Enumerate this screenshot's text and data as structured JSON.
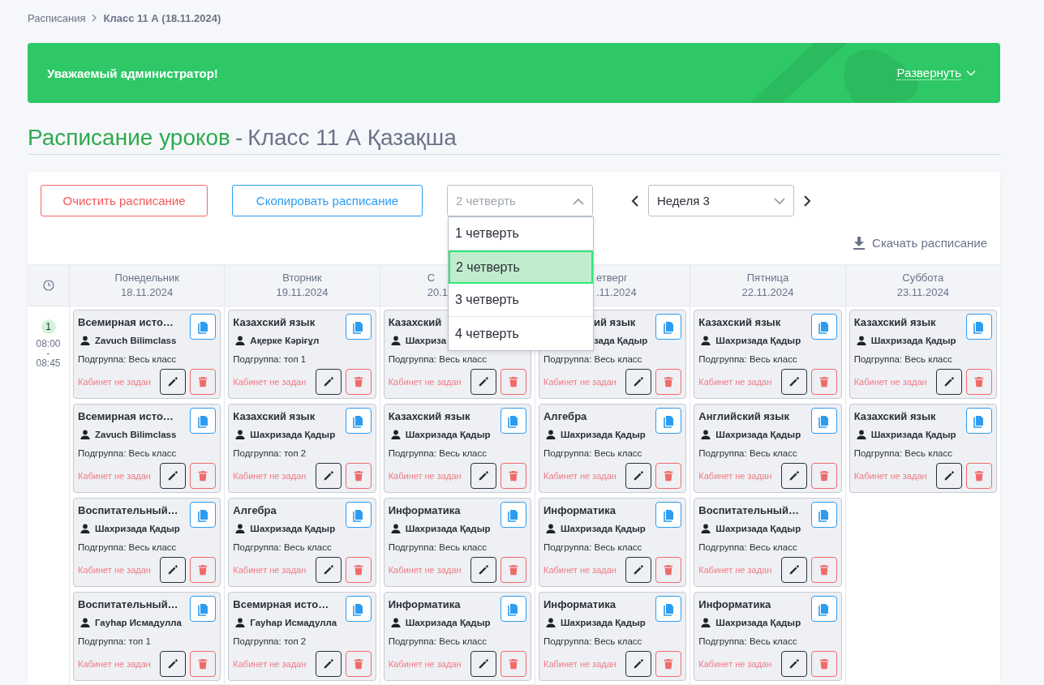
{
  "breadcrumb": [
    {
      "label": "Расписания",
      "kind": "link"
    },
    {
      "label": "Класс 11 А (18.11.2024)",
      "kind": "current"
    }
  ],
  "banner": {
    "text": "Уважаемый администратор!",
    "toggle": "Развернуть",
    "expanded": false
  },
  "heading": {
    "title": "Расписание уроков",
    "separator": "-",
    "subtitle": "Класс 11 А Қазақша"
  },
  "toolbar": {
    "clear_button": "Очистить расписание",
    "copy_button": "Скопировать расписание",
    "quarter_select": {
      "value": "2 четверть",
      "expanded": true,
      "options": [
        {
          "label": "1 четверть",
          "selected": false
        },
        {
          "label": "2 четверть",
          "selected": true
        },
        {
          "label": "3 четверть",
          "selected": false
        },
        {
          "label": "4 четверть",
          "selected": false
        }
      ]
    },
    "week_select": {
      "value": "Неделя 3"
    },
    "download": "Скачать расписание"
  },
  "days": [
    {
      "name": "Понедельник",
      "date": "18.11.2024",
      "kind": "full"
    },
    {
      "name": "Вторник",
      "date": "19.11.2024",
      "kind": "full"
    },
    {
      "name": "С",
      "date": "20.1",
      "kind": "tail-covered"
    },
    {
      "name": "етверг",
      "date": ".11.2024",
      "kind": "head-covered"
    },
    {
      "name": "Пятница",
      "date": "22.11.2024",
      "kind": "full"
    },
    {
      "name": "Суббота",
      "date": "23.11.2024",
      "kind": "full"
    }
  ],
  "slots": [
    {
      "number": "1",
      "start": "08:00",
      "dash": "-",
      "end": "08:45",
      "cells": [
        [
          {
            "subject": "Всемирная исто…",
            "teacher": "Zavuch Bilimclass",
            "subgroup": "Подгруппа: Весь класс",
            "room": "Кабинет не задан",
            "kind": "full"
          },
          {
            "subject": "Всемирная исто…",
            "teacher": "Zavuch Bilimclass",
            "subgroup": "Подгруппа: Весь класс",
            "room": "Кабинет не задан",
            "kind": "full"
          },
          {
            "subject": "Воспитательный…",
            "teacher": "Шахризада Қадыр",
            "subgroup": "Подгруппа: Весь класс",
            "room": "Кабинет не задан",
            "kind": "full"
          },
          {
            "subject": "Воспитательный…",
            "teacher": "Гауһар Исмадулла",
            "subgroup": "Подгруппа: топ 1",
            "room": "Кабинет не задан",
            "kind": "full"
          }
        ],
        [
          {
            "subject": "Казахский язык",
            "teacher": "Ақерке Кәріғұл",
            "subgroup": "Подгруппа: топ 1",
            "room": "Кабинет не задан",
            "kind": "full"
          },
          {
            "subject": "Казахский язык",
            "teacher": "Шахризада Қадыр",
            "subgroup": "Подгруппа: топ 2",
            "room": "Кабинет не задан",
            "kind": "full"
          },
          {
            "subject": "Алгебра",
            "teacher": "Шахризада Қадыр",
            "subgroup": "Подгруппа: Весь класс",
            "room": "Кабинет не задан",
            "kind": "full"
          },
          {
            "subject": "Всемирная исто…",
            "teacher": "Гауһар Исмадулла",
            "subgroup": "Подгруппа: топ 2",
            "room": "Кабинет не задан",
            "kind": "full"
          }
        ],
        [
          {
            "subject": "Казахский",
            "teacher": "Шахриза",
            "subgroup": "Подгруппа: Весь класс",
            "room": "Кабинет не задан",
            "kind": "tail-covered"
          },
          {
            "subject": "Казахский язык",
            "teacher": "Шахризада Қадыр",
            "subgroup": "Подгруппа: Весь класс",
            "room": "Кабинет не задан",
            "kind": "full"
          },
          {
            "subject": "Информатика",
            "teacher": "Шахризада Қадыр",
            "subgroup": "Подгруппа: Весь класс",
            "room": "Кабинет не задан",
            "kind": "full"
          },
          {
            "subject": "Информатика",
            "teacher": "Шахризада Қадыр",
            "subgroup": "Подгруппа: Весь класс",
            "room": "Кабинет не задан",
            "kind": "full"
          }
        ],
        [
          {
            "subject": "ий язык",
            "teacher": "зада Қадыр",
            "subgroup": "Подгруппа: Весь класс",
            "room": "Кабинет не задан",
            "kind": "head-covered"
          },
          {
            "subject": "Алгебра",
            "teacher": "Шахризада Қадыр",
            "subgroup": "Подгруппа: Весь класс",
            "room": "Кабинет не задан",
            "kind": "full"
          },
          {
            "subject": "Информатика",
            "teacher": "Шахризада Қадыр",
            "subgroup": "Подгруппа: Весь класс",
            "room": "Кабинет не задан",
            "kind": "full"
          },
          {
            "subject": "Информатика",
            "teacher": "Шахризада Қадыр",
            "subgroup": "Подгруппа: Весь класс",
            "room": "Кабинет не задан",
            "kind": "full"
          }
        ],
        [
          {
            "subject": "Казахский язык",
            "teacher": "Шахризада Қадыр",
            "subgroup": "Подгруппа: Весь класс",
            "room": "Кабинет не задан",
            "kind": "full"
          },
          {
            "subject": "Английский язык",
            "teacher": "Шахризада Қадыр",
            "subgroup": "Подгруппа: Весь класс",
            "room": "Кабинет не задан",
            "kind": "full"
          },
          {
            "subject": "Воспитательный…",
            "teacher": "Шахризада Қадыр",
            "subgroup": "Подгруппа: Весь класс",
            "room": "Кабинет не задан",
            "kind": "full"
          },
          {
            "subject": "Информатика",
            "teacher": "Шахризада Қадыр",
            "subgroup": "Подгруппа: Весь класс",
            "room": "Кабинет не задан",
            "kind": "full"
          }
        ],
        [
          {
            "subject": "Казахский язык",
            "teacher": "Шахризада Қадыр",
            "subgroup": "Подгруппа: Весь класс",
            "room": "Кабинет не задан",
            "kind": "full"
          },
          {
            "subject": "Казахский язык",
            "teacher": "Шахризада Қадыр",
            "subgroup": "Подгруппа: Весь класс",
            "room": "Кабинет не задан",
            "kind": "full"
          }
        ]
      ]
    }
  ]
}
